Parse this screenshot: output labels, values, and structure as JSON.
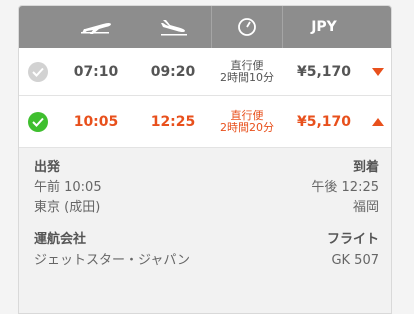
{
  "header": {
    "currency": "JPY",
    "icons": [
      "departure-plane-icon",
      "arrival-plane-icon",
      "duration-clock-icon"
    ]
  },
  "flights": [
    {
      "depart": "07:10",
      "arrive": "09:20",
      "type": "直行便",
      "duration": "2時間10分",
      "price": "¥5,170",
      "selected": false
    },
    {
      "depart": "10:05",
      "arrive": "12:25",
      "type": "直行便",
      "duration": "2時間20分",
      "price": "¥5,170",
      "selected": true
    }
  ],
  "details": {
    "departure_label": "出発",
    "arrival_label": "到着",
    "departure_time": "午前 10:05",
    "arrival_time": "午後 12:25",
    "departure_airport": "東京 (成田)",
    "arrival_airport": "福岡",
    "airline_label": "運航会社",
    "flight_label": "フライト",
    "airline": "ジェットスター・ジャパン",
    "flight_number": "GK 507"
  },
  "colors": {
    "accent": "#e8501c",
    "selected_check": "#3fbf2f",
    "header_bg": "#8d8d8d"
  }
}
